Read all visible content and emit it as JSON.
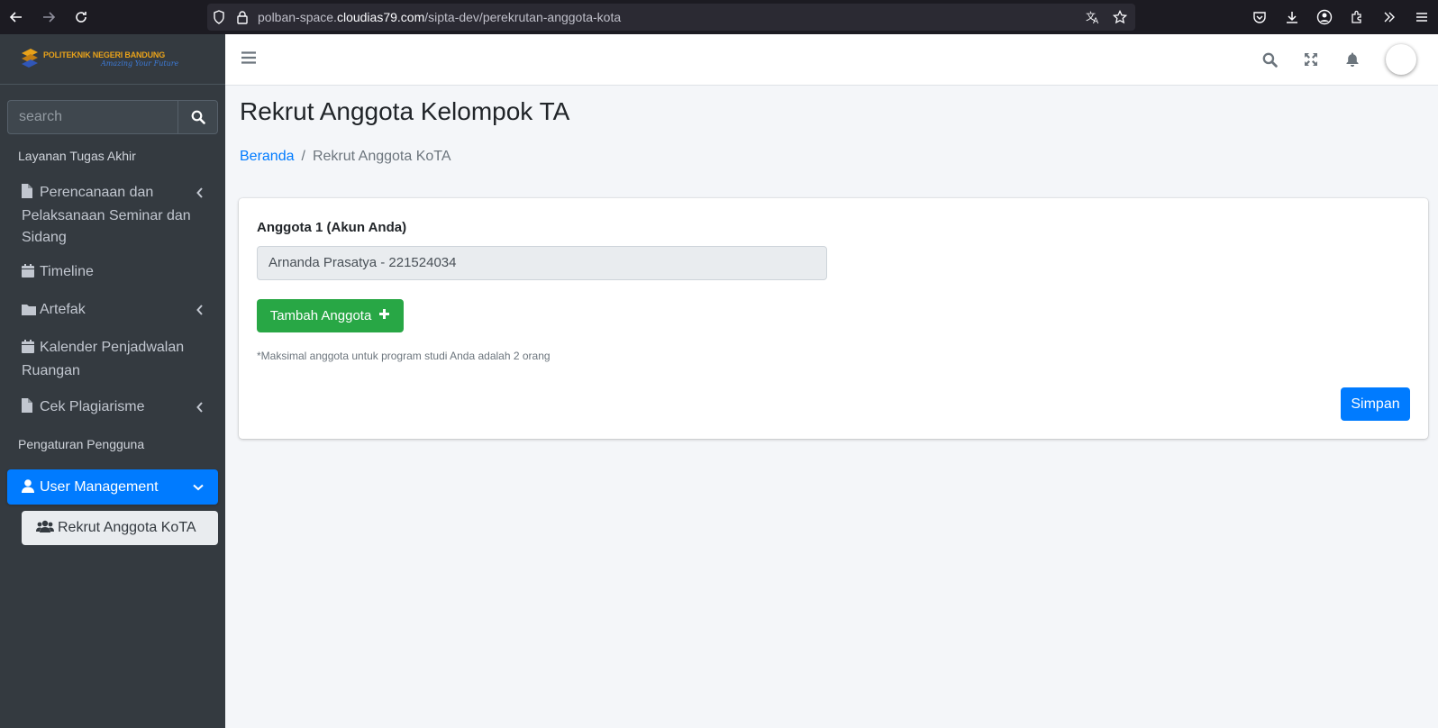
{
  "browser": {
    "url_prefix": "polban-space.",
    "url_host": "cloudias79.com",
    "url_path": "/sipta-dev/perekrutan-anggota-kota"
  },
  "brand": {
    "name": "POLITEKNIK NEGERI BANDUNG",
    "tagline": "Amazing Your Future"
  },
  "sidebar": {
    "search_placeholder": "search",
    "header_1": "Layanan Tugas Akhir",
    "items": [
      {
        "label": "Perencanaan dan Pelaksanaan Seminar dan Sidang",
        "icon": "file-icon"
      },
      {
        "label": "Timeline",
        "icon": "calendar-icon"
      },
      {
        "label": "Artefak",
        "icon": "folder-icon"
      },
      {
        "label": "Kalender Penjadwalan Ruangan",
        "icon": "calendar-icon"
      },
      {
        "label": "Cek Plagiarisme",
        "icon": "file-icon"
      }
    ],
    "header_2": "Pengaturan Pengguna",
    "user_management": "User Management",
    "sub_item": "Rekrut Anggota KoTA"
  },
  "page": {
    "title": "Rekrut Anggota Kelompok TA",
    "breadcrumb_home": "Beranda",
    "breadcrumb_sep": "/",
    "breadcrumb_current": "Rekrut Anggota KoTA"
  },
  "form": {
    "member_label": "Anggota 1 (Akun Anda)",
    "member_value": "Arnanda Prasatya - 221524034",
    "add_button": "Tambah Anggota",
    "note": "*Maksimal anggota untuk program studi Anda adalah 2 orang",
    "save_button": "Simpan"
  },
  "colors": {
    "primary": "#007bff",
    "success": "#28a745",
    "sidebar_bg": "#343a40"
  }
}
